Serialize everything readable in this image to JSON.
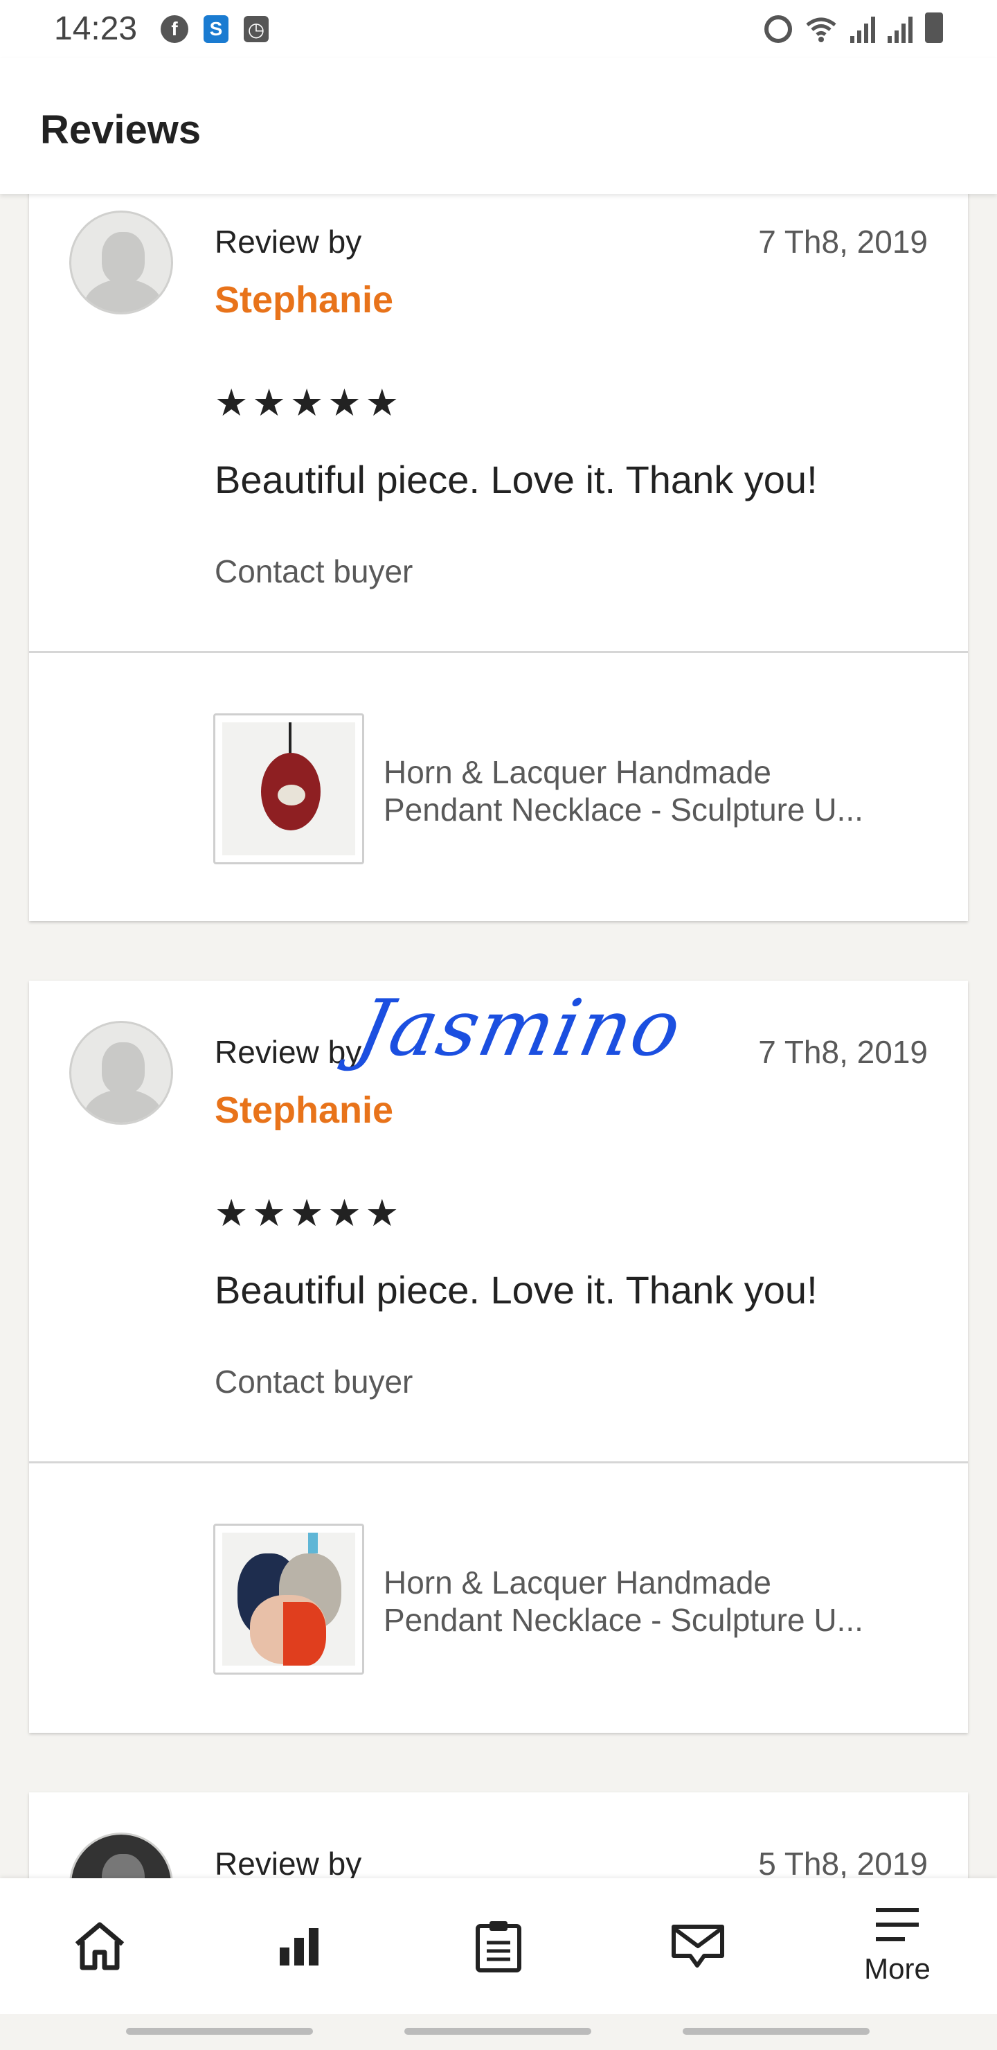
{
  "status_bar": {
    "time": "14:23",
    "left_icons": [
      "facebook-icon",
      "s-app-icon",
      "clock-app-icon"
    ],
    "right_icons": [
      "alarm-icon",
      "wifi-icon",
      "signal-icon",
      "signal-icon",
      "battery-icon"
    ]
  },
  "header": {
    "title": "Reviews"
  },
  "reviews": [
    {
      "review_by_label": "Review by",
      "reviewer": "Stephanie",
      "date": "7 Th8, 2019",
      "stars": "★★★★★",
      "rating": 5,
      "text": "Beautiful piece. Love it. Thank you!",
      "contact_label": "Contact buyer",
      "product_title_line1": "Horn & Lacquer Handmade",
      "product_title_line2": "Pendant Necklace - Sculpture U..."
    },
    {
      "review_by_label": "Review by",
      "reviewer": "Stephanie",
      "date": "7 Th8, 2019",
      "stars": "★★★★★",
      "rating": 5,
      "text": "Beautiful piece. Love it. Thank you!",
      "contact_label": "Contact buyer",
      "product_title_line1": "Horn & Lacquer Handmade",
      "product_title_line2": "Pendant Necklace - Sculpture U..."
    },
    {
      "review_by_label": "Review by",
      "date": "5 Th8, 2019"
    }
  ],
  "signature_overlay": "Jasmino",
  "bottom_nav": {
    "items": [
      {
        "icon": "home-icon",
        "label": ""
      },
      {
        "icon": "stats-icon",
        "label": ""
      },
      {
        "icon": "orders-clipboard-icon",
        "label": ""
      },
      {
        "icon": "messages-icon",
        "label": ""
      },
      {
        "icon": "menu-icon",
        "label": "More"
      }
    ]
  }
}
